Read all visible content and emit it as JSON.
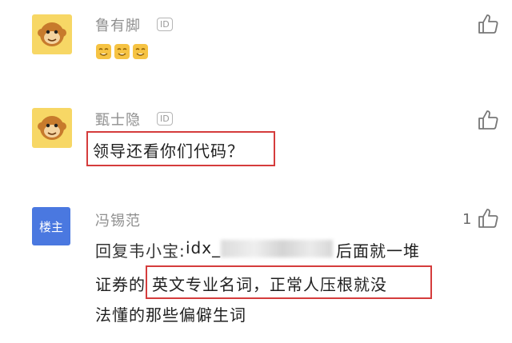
{
  "comments": [
    {
      "name": "鲁有脚",
      "id_badge": "ID",
      "body_emoji_count": 3,
      "like_count": ""
    },
    {
      "name": "甄士隐",
      "id_badge": "ID",
      "body": "领导还看你们代码？",
      "like_count": ""
    },
    {
      "host_label": "楼主",
      "name": "冯锡范",
      "body_line1_prefix": "回复韦小宝:",
      "body_line1_visible": "idx_",
      "body_line1_suffix": "后面就一堆",
      "body_line2_a": "证券的",
      "body_line2_b": "英文专业名词，正常人压根就没",
      "body_line3": "法懂的那些偏僻生词",
      "like_count": "1"
    }
  ],
  "colors": {
    "avatar_bg": "#f7d765",
    "host_bg": "#4a78e0",
    "highlight_border": "#d53c3c"
  },
  "icons": [
    "monkey-avatar-icon",
    "thumbs-up-icon",
    "face-emoji-icon",
    "id-badge-icon"
  ]
}
